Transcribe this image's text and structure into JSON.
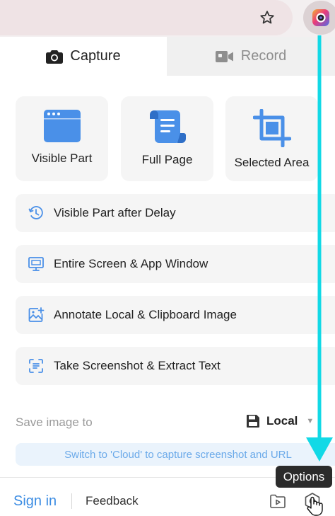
{
  "tabs": {
    "capture_label": "Capture",
    "record_label": "Record"
  },
  "capture_options": [
    {
      "label": "Visible Part",
      "icon": "browser-window-icon"
    },
    {
      "label": "Full Page",
      "icon": "scroll-page-icon"
    },
    {
      "label": "Selected Area",
      "icon": "crop-icon"
    }
  ],
  "rows": [
    {
      "label": "Visible Part after Delay",
      "icon": "timer-icon"
    },
    {
      "label": "Entire Screen & App Window",
      "icon": "monitor-icon"
    },
    {
      "label": "Annotate Local & Clipboard Image",
      "icon": "image-add-icon"
    },
    {
      "label": "Take Screenshot & Extract Text",
      "icon": "scan-text-icon"
    }
  ],
  "save": {
    "label": "Save image to",
    "value": "Local",
    "hint": "Switch to 'Cloud' to capture screenshot and URL"
  },
  "footer": {
    "sign_in": "Sign in",
    "feedback": "Feedback",
    "tooltip": "Options"
  },
  "colors": {
    "accent": "#3b8ce3",
    "icon_blue": "#4a90e8",
    "annotation_arrow": "#12d9e6"
  }
}
